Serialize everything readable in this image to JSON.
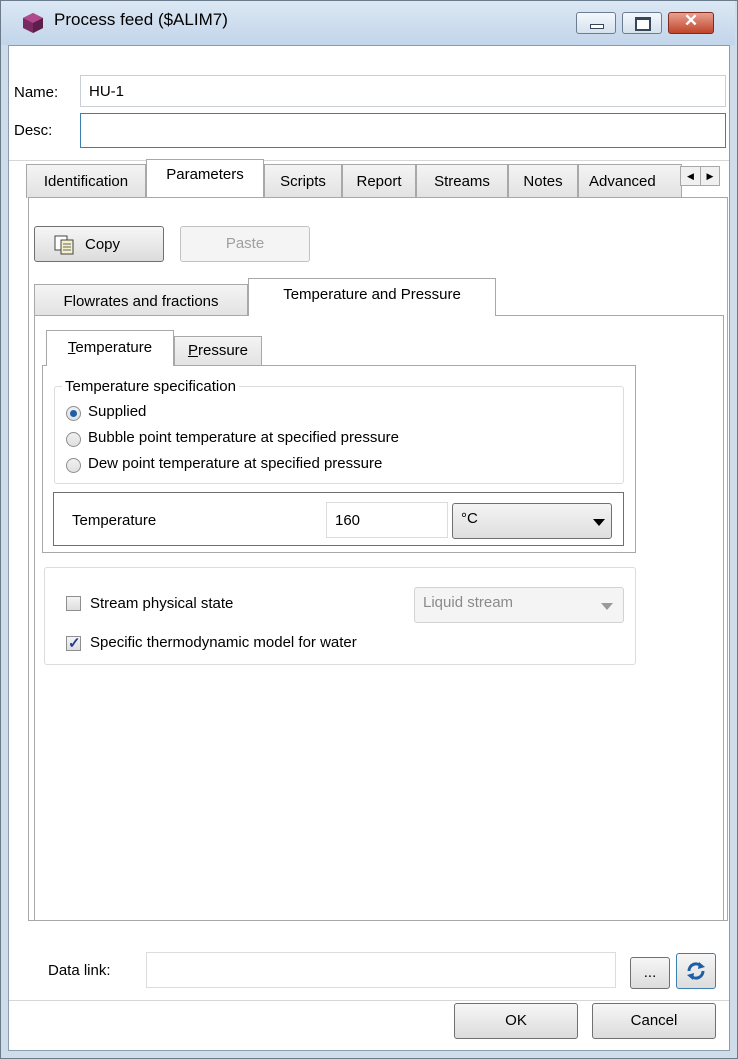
{
  "window": {
    "title": "Process feed ($ALIM7)"
  },
  "header": {
    "name_label": "Name:",
    "name_value": "HU-1",
    "desc_label": "Desc:",
    "desc_value": ""
  },
  "main_tabs": [
    {
      "label": "Identification",
      "active": false
    },
    {
      "label": "Parameters",
      "active": true
    },
    {
      "label": "Scripts",
      "active": false
    },
    {
      "label": "Report",
      "active": false
    },
    {
      "label": "Streams",
      "active": false
    },
    {
      "label": "Notes",
      "active": false
    },
    {
      "label": "Advanced",
      "active": false
    }
  ],
  "toolbar": {
    "copy_label": "Copy",
    "paste_label": "Paste"
  },
  "sub_tabs": [
    {
      "label": "Flowrates and fractions",
      "active": false
    },
    {
      "label": "Temperature and Pressure",
      "active": true
    }
  ],
  "inner_tabs": [
    {
      "label_mnemonic": "T",
      "label_rest": "emperature",
      "active": true
    },
    {
      "label_mnemonic": "P",
      "label_rest": "ressure",
      "active": false
    }
  ],
  "temperature_spec": {
    "legend": "Temperature specification",
    "options": [
      {
        "label": "Supplied",
        "checked": true
      },
      {
        "label": "Bubble point temperature at specified pressure",
        "checked": false
      },
      {
        "label": "Dew point temperature at specified pressure",
        "checked": false
      }
    ]
  },
  "temperature_field": {
    "label": "Temperature",
    "value": "160",
    "unit": "°C"
  },
  "options": {
    "physical_state_label": "Stream physical state",
    "physical_state_checked": false,
    "physical_state_value": "Liquid stream",
    "thermo_model_label": "Specific thermodynamic model for water",
    "thermo_model_checked": true
  },
  "footer": {
    "data_link_label": "Data link:",
    "data_link_value": "",
    "browse_label": "...",
    "ok_label": "OK",
    "cancel_label": "Cancel"
  },
  "colors": {
    "title_bar": "#cfdcea",
    "close_button": "#c0452c",
    "accent_blue": "#1e5ea8"
  }
}
